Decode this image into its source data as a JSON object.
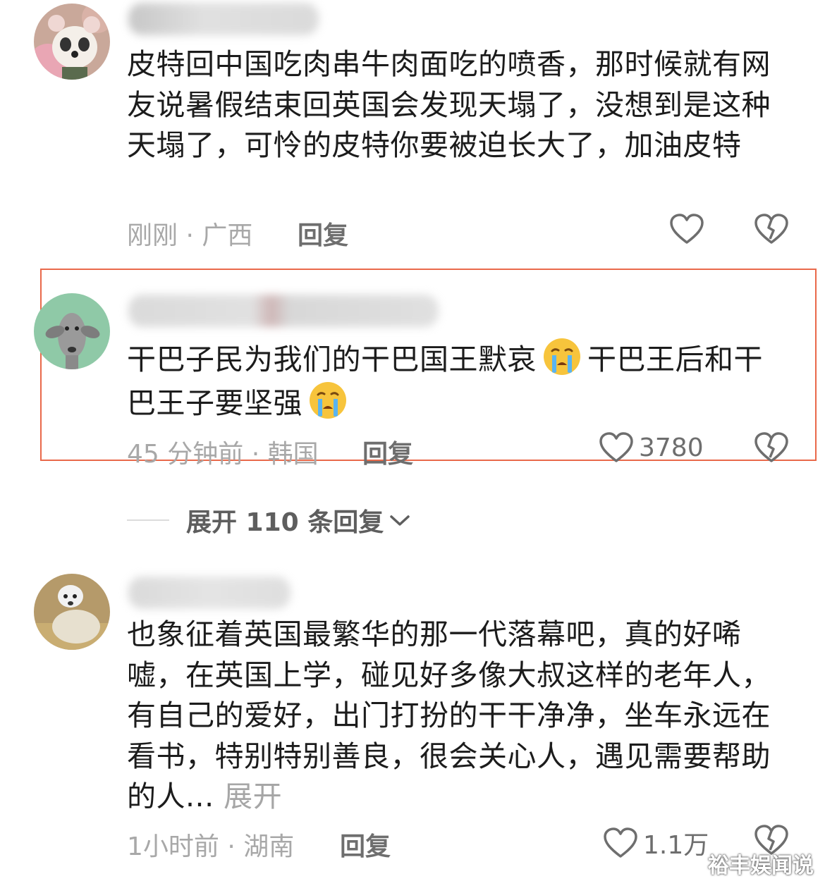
{
  "comments": [
    {
      "text": "皮特回中国吃肉串牛肉面吃的喷香，那时候就有网友说暑假结束回英国会发现天塌了，没想到是这种天塌了，可怜的皮特你要被迫长大了，加油皮特",
      "meta": "刚刚 · 广西",
      "reply_label": "回复",
      "like_count": "",
      "avatar_icon": "panda-avatar-icon"
    },
    {
      "text_part1": "干巴子民为我们的干巴国王默哀",
      "text_part2": "干巴王后和干巴王子要坚强",
      "emoji_icon": "crying-face-icon",
      "meta": "45 分钟前 · 韩国",
      "reply_label": "回复",
      "like_count": "3780",
      "avatar_icon": "dog-avatar-icon"
    },
    {
      "text": "也象征着英国最繁华的那一代落幕吧，真的好唏嘘，在英国上学，碰见好多像大叔这样的老年人，有自己的爱好，出门打扮的干干净净，坐车永远在看书，特别特别善良，很会关心人，遇见需要帮助的人...",
      "expand_label": "展开",
      "meta": "1小时前 · 湖南",
      "reply_label": "回复",
      "like_count": "1.1万",
      "avatar_icon": "sheep-avatar-icon"
    }
  ],
  "expand_replies": {
    "label": "展开 110 条回复"
  },
  "watermark": "裕丰娱闻说",
  "colors": {
    "highlight": "#e9694a",
    "meta": "#a8a8a8",
    "text": "#1c1c1c"
  }
}
